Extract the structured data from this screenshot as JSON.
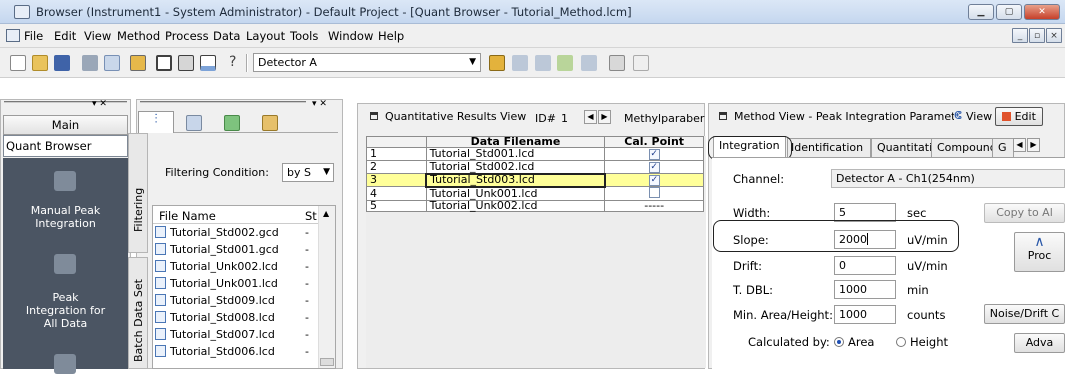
{
  "window": {
    "title": "Browser (Instrument1 - System Administrator) - Default Project - [Quant Browser - Tutorial_Method.lcm]"
  },
  "menu": [
    "File",
    "Edit",
    "View",
    "Method",
    "Process",
    "Data",
    "Layout",
    "Tools",
    "Window",
    "Help"
  ],
  "toolbar": {
    "detector_select": "Detector A"
  },
  "nav": {
    "main_label": "Main",
    "quant_browser": "Quant Browser",
    "items": [
      "Manual Peak Integration",
      "Peak Integration for All Data"
    ]
  },
  "file_panel": {
    "filtering_tab": "Filtering",
    "batch_tab": "Batch Data Set",
    "filter_label": "Filtering Condition:",
    "filter_value": "by S",
    "col_file": "File Name",
    "col_st": "St",
    "files": [
      {
        "name": "Tutorial_Std002.gcd",
        "st": "-"
      },
      {
        "name": "Tutorial_Std001.gcd",
        "st": "-"
      },
      {
        "name": "Tutorial_Unk002.lcd",
        "st": "-"
      },
      {
        "name": "Tutorial_Unk001.lcd",
        "st": "-"
      },
      {
        "name": "Tutorial_Std009.lcd",
        "st": "-"
      },
      {
        "name": "Tutorial_Std008.lcd",
        "st": "-"
      },
      {
        "name": "Tutorial_Std007.lcd",
        "st": "-"
      },
      {
        "name": "Tutorial_Std006.lcd",
        "st": "-"
      }
    ]
  },
  "quant_view": {
    "title": "Quantitative Results View",
    "id_label": "ID#",
    "id_value": "1",
    "compound": "Methylparaber",
    "col_file": "Data Filename",
    "col_cal": "Cal. Point",
    "rows": [
      {
        "n": "1",
        "file": "Tutorial_Std001.lcd",
        "cal": "✓"
      },
      {
        "n": "2",
        "file": "Tutorial_Std002.lcd",
        "cal": "✓"
      },
      {
        "n": "3",
        "file": "Tutorial_Std003.lcd",
        "cal": "✓"
      },
      {
        "n": "4",
        "file": "Tutorial_Unk001.lcd",
        "cal": ""
      },
      {
        "n": "5",
        "file": "Tutorial_Unk002.lcd",
        "cal": "-----"
      }
    ]
  },
  "method_view": {
    "title": "Method View - Peak Integration Parameters",
    "view_btn": "View",
    "edit_btn": "Edit",
    "tabs": [
      "Integration",
      "Identification",
      "Quantitative",
      "Compound",
      "G"
    ],
    "channel_label": "Channel:",
    "channel_value": "Detector A - Ch1(254nm)",
    "width_label": "Width:",
    "width_value": "5",
    "width_unit": "sec",
    "slope_label": "Slope:",
    "slope_value": "2000",
    "slope_unit": "uV/min",
    "drift_label": "Drift:",
    "drift_value": "0",
    "drift_unit": "uV/min",
    "tdbl_label": "T. DBL:",
    "tdbl_value": "1000",
    "tdbl_unit": "min",
    "minarea_label": "Min. Area/Height:",
    "minarea_value": "1000",
    "minarea_unit": "counts",
    "calc_label": "Calculated by:",
    "calc_area": "Area",
    "calc_height": "Height",
    "copy_btn": "Copy to Al",
    "prog_btn": "Proc",
    "noise_btn": "Noise/Drift C",
    "adv_btn": "Adva"
  }
}
